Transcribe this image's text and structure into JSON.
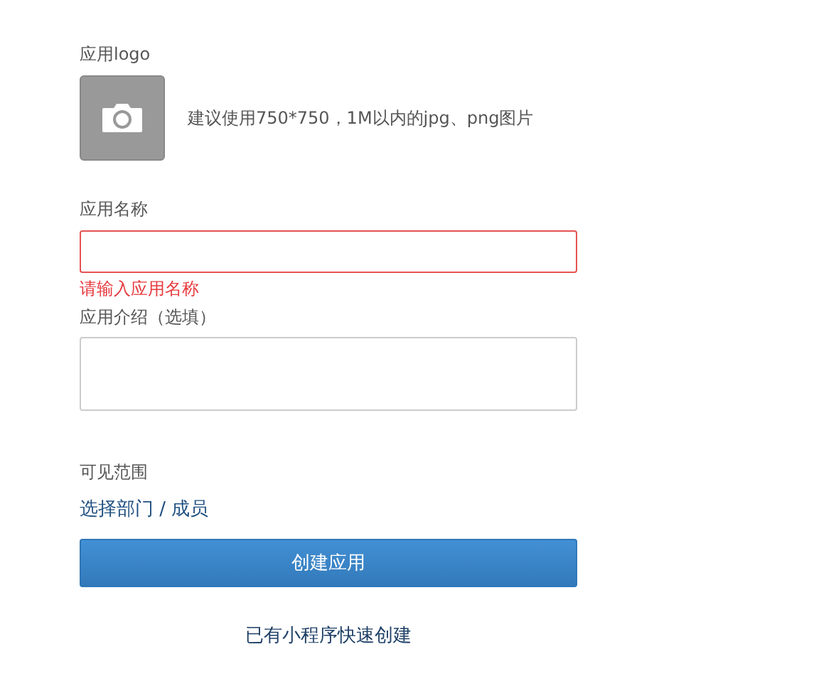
{
  "logo": {
    "label": "应用logo",
    "hint": "建议使用750*750，1M以内的jpg、png图片"
  },
  "name_field": {
    "label": "应用名称",
    "invalid": true,
    "error": "请输入应用名称"
  },
  "intro_field": {
    "label": "应用介绍（选填）"
  },
  "visibility": {
    "label": "可见范围",
    "link": "选择部门 / 成员"
  },
  "create_button": "创建应用",
  "quick_create_link": "已有小程序快速创建"
}
